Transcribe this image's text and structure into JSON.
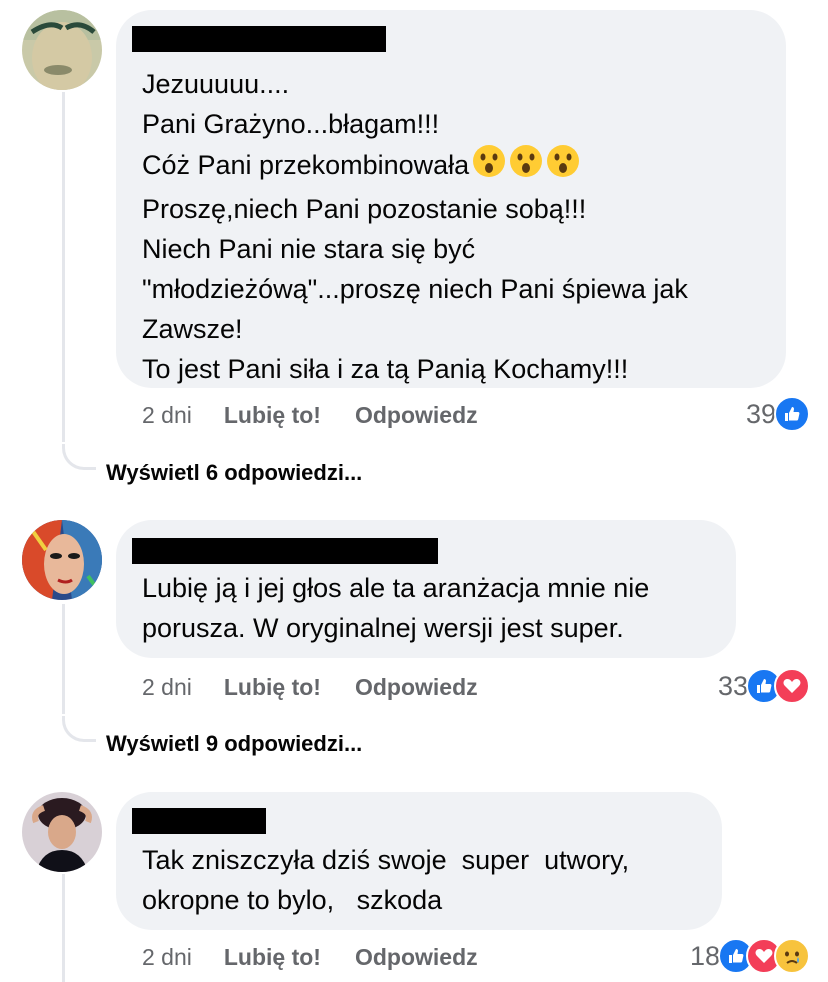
{
  "comments": [
    {
      "lines": [
        "Jezuuuuu....",
        "Pani Grażyno...błagam!!!",
        "Cóż Pani przekombinowała",
        "Proszę,niech Pani pozostanie sobą!!!",
        "Niech Pani nie stara się być",
        "\"młodzieżówą\"...proszę niech Pani śpiewa jak",
        "Zawsze!",
        "To jest Pani siła i za tą Panią Kochamy!!!"
      ],
      "emoji_line_suffix": [
        "😲",
        "😲",
        "😲"
      ],
      "time": "2 dni",
      "like_label": "Lubię to!",
      "reply_label": "Odpowiedz",
      "reaction_count": "39",
      "reactions": [
        "like-icon"
      ],
      "view_replies": "Wyświetl 6 odpowiedzi..."
    },
    {
      "lines": [
        "Lubię ją i jej głos ale ta aranżacja mnie nie",
        "porusza. W oryginalnej wersji jest super."
      ],
      "time": "2 dni",
      "like_label": "Lubię to!",
      "reply_label": "Odpowiedz",
      "reaction_count": "33",
      "reactions": [
        "like-icon",
        "love-icon"
      ],
      "view_replies": "Wyświetl 9 odpowiedzi..."
    },
    {
      "lines": [
        "Tak zniszczyła dziś swoje  super  utwory,",
        "okropne to bylo,   szkoda"
      ],
      "time": "2 dni",
      "like_label": "Lubię to!",
      "reply_label": "Odpowiedz",
      "reaction_count": "18",
      "reactions": [
        "like-icon",
        "love-icon",
        "sad-icon"
      ]
    }
  ],
  "colors": {
    "bubble": "#f0f2f5",
    "meta_text": "#65676b",
    "like_blue": "#1877f2",
    "love_red": "#f33e58"
  }
}
